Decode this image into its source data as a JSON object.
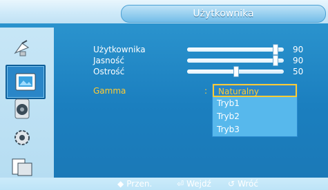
{
  "header": {
    "title": "Użytkownika"
  },
  "sidebar": {
    "items": [
      {
        "icon": "satellite-dish-icon"
      },
      {
        "icon": "picture-icon",
        "selected": true
      },
      {
        "icon": "speaker-icon"
      },
      {
        "icon": "gear-icon"
      },
      {
        "icon": "multi-window-icon"
      }
    ]
  },
  "settings": [
    {
      "label": "Użytkownika",
      "value": "90",
      "percent": 90
    },
    {
      "label": "Jasność",
      "value": "90",
      "percent": 90
    },
    {
      "label": "Ostrość",
      "value": "50",
      "percent": 50
    }
  ],
  "gamma": {
    "label": "Gamma",
    "colon": ":",
    "options": [
      "Naturalny",
      "Tryb1",
      "Tryb2",
      "Tryb3"
    ],
    "selected_index": 0
  },
  "footer": {
    "move_label": "Przen.",
    "enter_label": "Wejdź",
    "back_label": "Wróć"
  },
  "colors": {
    "highlight": "#ffcc33",
    "panel": "#1b7fbf"
  }
}
